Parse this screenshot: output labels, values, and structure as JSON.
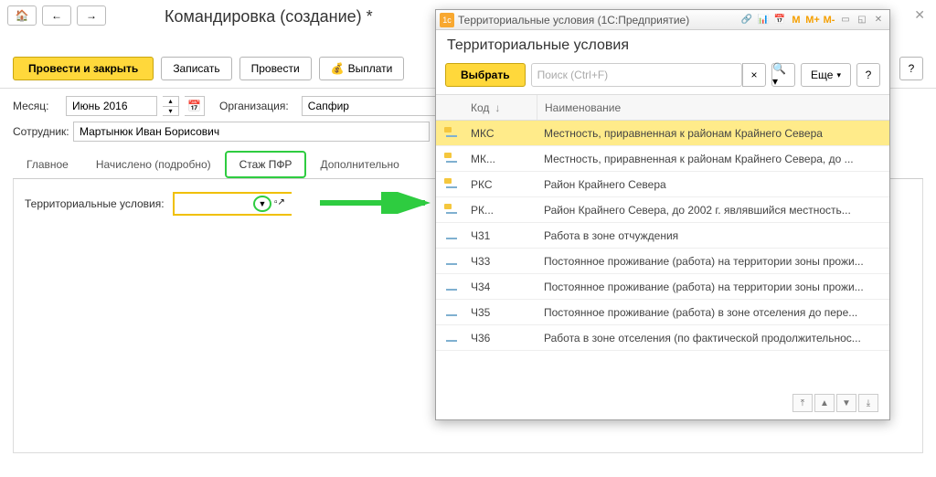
{
  "main": {
    "title": "Командировка (создание) *",
    "toolbar": {
      "post_close": "Провести и закрыть",
      "save": "Записать",
      "post": "Провести",
      "payout": "Выплати"
    },
    "fields": {
      "month_label": "Месяц:",
      "month_value": "Июнь 2016",
      "org_label": "Организация:",
      "org_value": "Сапфир",
      "emp_label": "Сотрудник:",
      "emp_value": "Мартынюк Иван Борисович"
    },
    "tabs": {
      "t1": "Главное",
      "t2": "Начислено (подробно)",
      "t3": "Стаж ПФР",
      "t4": "Дополнительно"
    },
    "terr_label": "Территориальные условия:"
  },
  "modal": {
    "titlebar": "Территориальные условия (1С:Предприятие)",
    "m_items": {
      "m": "M",
      "mp": "M+",
      "mm": "M-"
    },
    "header": "Территориальные условия",
    "select_btn": "Выбрать",
    "search_placeholder": "Поиск (Ctrl+F)",
    "more_btn": "Еще",
    "columns": {
      "code": "Код",
      "name": "Наименование"
    },
    "sort_indicator": "↓",
    "rows": [
      {
        "code": "МКС",
        "name": "Местность, приравненная к районам Крайнего Севера",
        "icon": "yellow",
        "selected": true
      },
      {
        "code": "МК...",
        "name": "Местность, приравненная к районам Крайнего Севера, до ...",
        "icon": "yellow"
      },
      {
        "code": "РКС",
        "name": "Район Крайнего Севера",
        "icon": "yellow"
      },
      {
        "code": "РК...",
        "name": "Район Крайнего Севера, до 2002 г. являвшийся местность...",
        "icon": "yellow"
      },
      {
        "code": "Ч31",
        "name": "Работа в зоне отчуждения",
        "icon": "plain"
      },
      {
        "code": "Ч33",
        "name": "Постоянное проживание (работа) на территории зоны прожи...",
        "icon": "plain"
      },
      {
        "code": "Ч34",
        "name": "Постоянное проживание (работа) на территории зоны прожи...",
        "icon": "plain"
      },
      {
        "code": "Ч35",
        "name": "Постоянное проживание (работа) в зоне отселения до пере...",
        "icon": "plain"
      },
      {
        "code": "Ч36",
        "name": "Работа в зоне отселения (по фактической продолжительнос...",
        "icon": "plain"
      }
    ]
  }
}
